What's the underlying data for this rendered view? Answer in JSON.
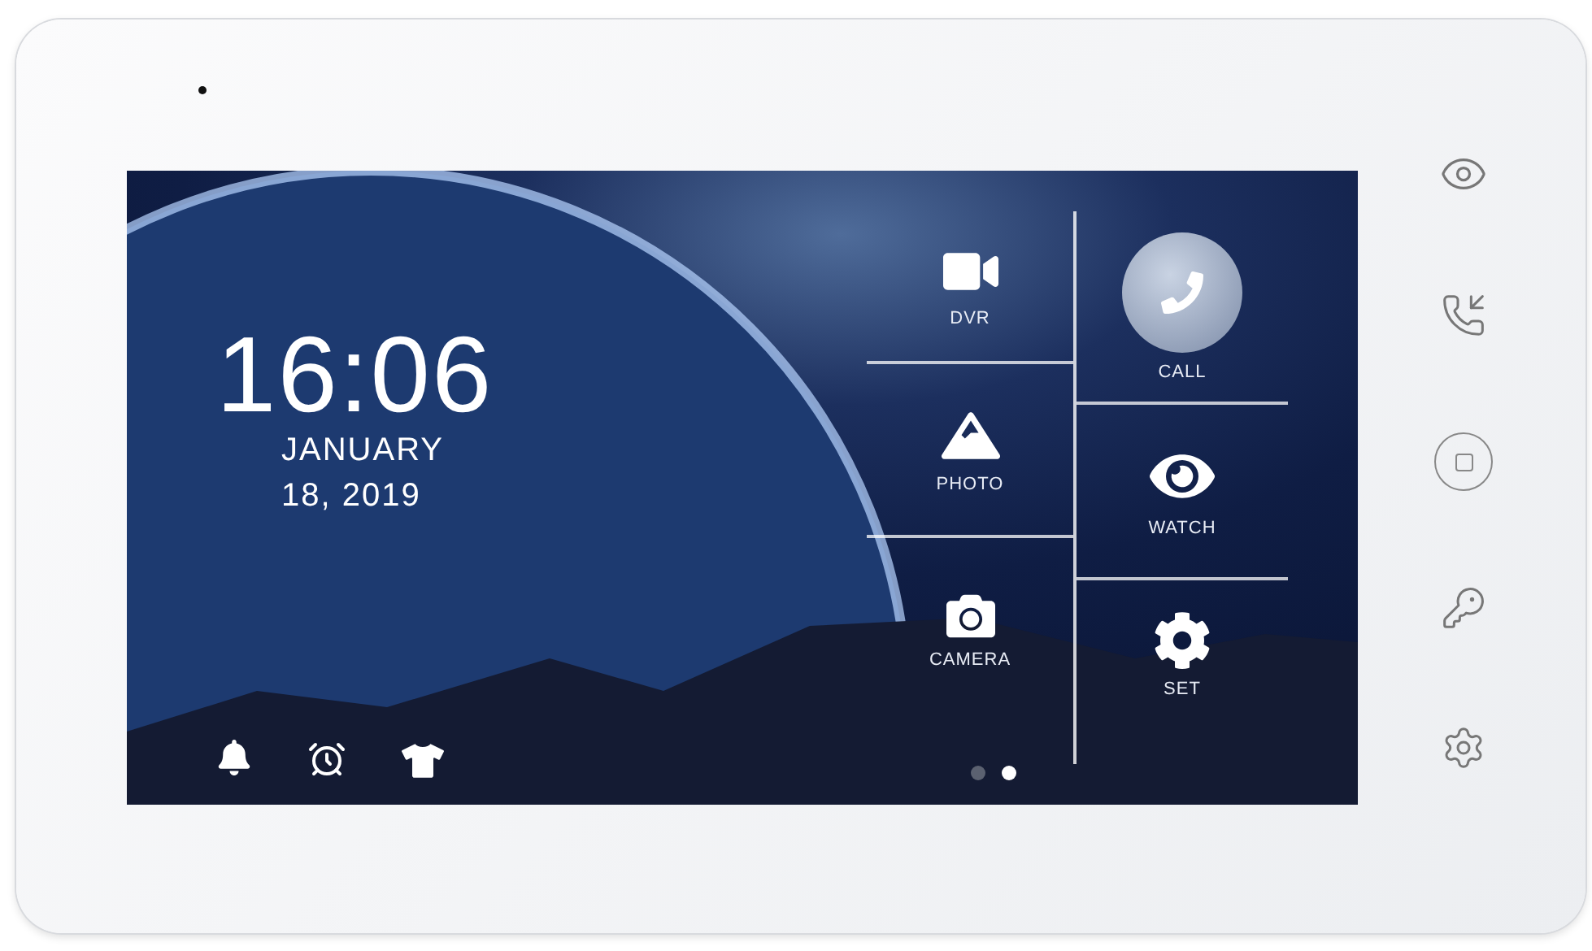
{
  "clock": {
    "time": "16:06",
    "date_lines": [
      "JANUARY",
      "18, 2019"
    ]
  },
  "shortcuts": [
    {
      "kind": "bell"
    },
    {
      "kind": "alarm"
    },
    {
      "kind": "shirt"
    }
  ],
  "tile_columns": [
    [
      {
        "kind": "dvr",
        "label": "DVR"
      },
      {
        "kind": "photo",
        "label": "PHOTO"
      },
      {
        "kind": "camera",
        "label": "CAMERA"
      }
    ],
    [
      {
        "kind": "call",
        "label": "CALL"
      },
      {
        "kind": "watch",
        "label": "WATCH"
      },
      {
        "kind": "set",
        "label": "SET"
      }
    ]
  ],
  "page_dots": [
    {
      "selected": false
    },
    {
      "selected": true
    }
  ],
  "side_buttons": [
    {
      "kind": "eye"
    },
    {
      "kind": "phone"
    },
    {
      "kind": "home"
    },
    {
      "kind": "key"
    },
    {
      "kind": "gear"
    }
  ]
}
